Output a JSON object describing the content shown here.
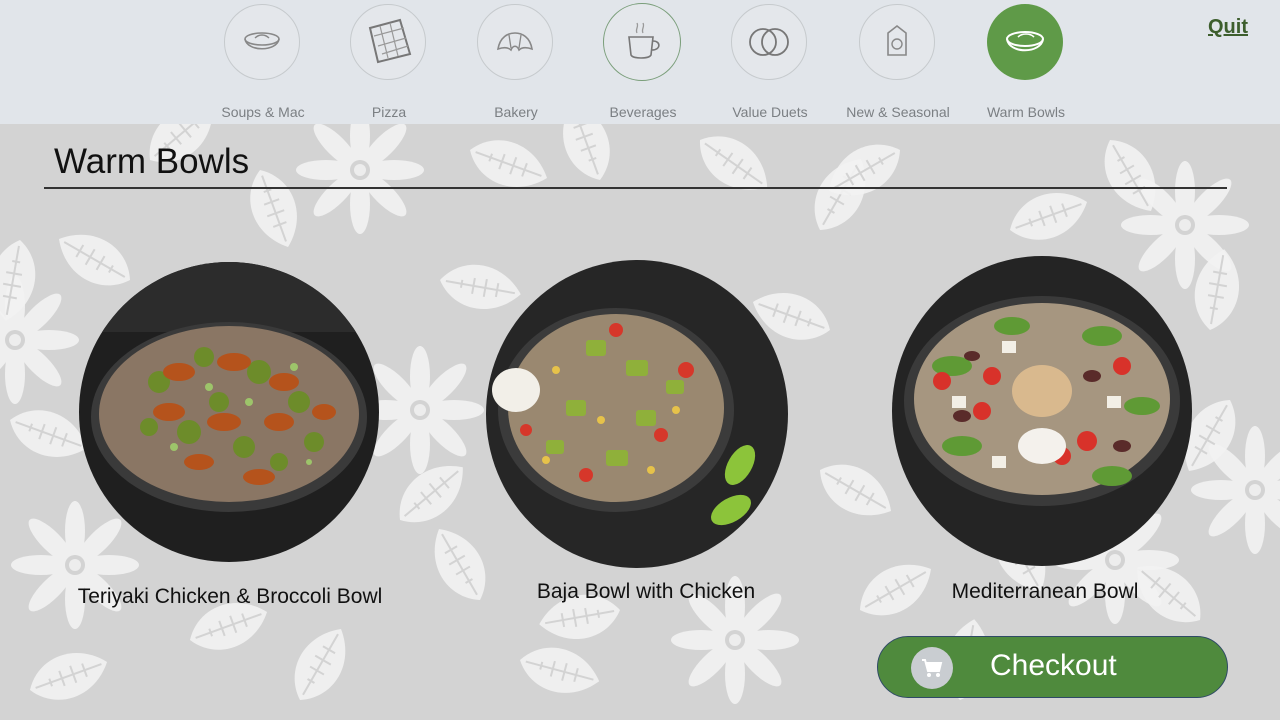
{
  "nav": {
    "categories": [
      {
        "label": "Soups & Mac",
        "icon": "soup-bowl-icon"
      },
      {
        "label": "Pizza",
        "icon": "pizza-icon"
      },
      {
        "label": "Bakery",
        "icon": "croissant-icon"
      },
      {
        "label": "Beverages",
        "icon": "coffee-cup-icon"
      },
      {
        "label": "Value Duets",
        "icon": "duet-rings-icon"
      },
      {
        "label": "New & Seasonal",
        "icon": "seasonal-tag-icon"
      },
      {
        "label": "Warm Bowls",
        "icon": "warm-bowl-icon"
      }
    ],
    "active_category": "Warm Bowls",
    "quit_label": "Quit"
  },
  "page": {
    "title": "Warm Bowls"
  },
  "items": [
    {
      "name": "Teriyaki Chicken & Broccoli Bowl"
    },
    {
      "name": "Baja Bowl with Chicken"
    },
    {
      "name": "Mediterranean Bowl"
    }
  ],
  "checkout": {
    "label": "Checkout",
    "icon": "cart-icon"
  },
  "colors": {
    "accent_green": "#5f9a48",
    "checkout_green": "#4f8a3d",
    "quit_green": "#3d5e2d"
  }
}
